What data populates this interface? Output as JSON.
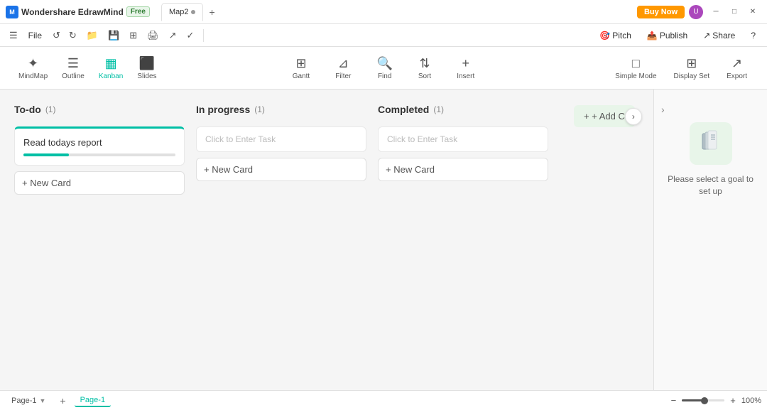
{
  "app": {
    "name": "Wondershare EdrawMind",
    "badge": "Free",
    "tab_name": "Map2",
    "buy_now": "Buy Now"
  },
  "menu": {
    "items": [
      "",
      "File"
    ],
    "undo_label": "↺",
    "redo_label": "↻"
  },
  "toolbar": {
    "tools": [
      {
        "id": "mindmap",
        "label": "MindMap",
        "icon": "✦"
      },
      {
        "id": "outline",
        "label": "Outline",
        "icon": "☰"
      },
      {
        "id": "kanban",
        "label": "Kanban",
        "icon": "▦"
      },
      {
        "id": "slides",
        "label": "Slides",
        "icon": "⬛"
      }
    ],
    "center_tools": [
      {
        "id": "gantt",
        "label": "Gantt",
        "icon": "⊞"
      },
      {
        "id": "filter",
        "label": "Filter",
        "icon": "⊿"
      },
      {
        "id": "find",
        "label": "Find",
        "icon": "🔍"
      },
      {
        "id": "sort",
        "label": "Sort",
        "icon": "⇅"
      },
      {
        "id": "insert",
        "label": "Insert",
        "icon": "+"
      }
    ],
    "right_tools": [
      {
        "id": "simple_mode",
        "label": "Simple Mode",
        "icon": "□"
      },
      {
        "id": "display_set",
        "label": "Display Set",
        "icon": "⊞"
      },
      {
        "id": "export",
        "label": "Export",
        "icon": "↗"
      }
    ]
  },
  "menu_bar_right": {
    "pitch": "Pitch",
    "publish": "Publish",
    "share": "Share",
    "help": "?"
  },
  "kanban": {
    "columns": [
      {
        "id": "todo",
        "title": "To-do",
        "count": "(1)",
        "color": "#00bfa5",
        "cards": [
          {
            "id": "card1",
            "task": "Read todays report",
            "has_progress": true,
            "progress": 30
          }
        ],
        "placeholder": null,
        "add_label": "+ New Card"
      },
      {
        "id": "in_progress",
        "title": "In progress",
        "count": "(1)",
        "color": "#00bfa5",
        "cards": [],
        "placeholder": "Click to Enter Task",
        "add_label": "+ New Card"
      },
      {
        "id": "completed",
        "title": "Completed",
        "count": "(1)",
        "color": "#00bfa5",
        "cards": [],
        "placeholder": "Click to Enter Task",
        "add_label": "+ New Card"
      }
    ],
    "add_column_label": "+ Add C"
  },
  "right_panel": {
    "goal_text": "Please select a goal to set up"
  },
  "bottom": {
    "page_label": "Page-1",
    "active_page": "Page-1",
    "add_page_icon": "+",
    "zoom_level": "100%",
    "zoom_minus": "−",
    "zoom_plus": "+"
  }
}
